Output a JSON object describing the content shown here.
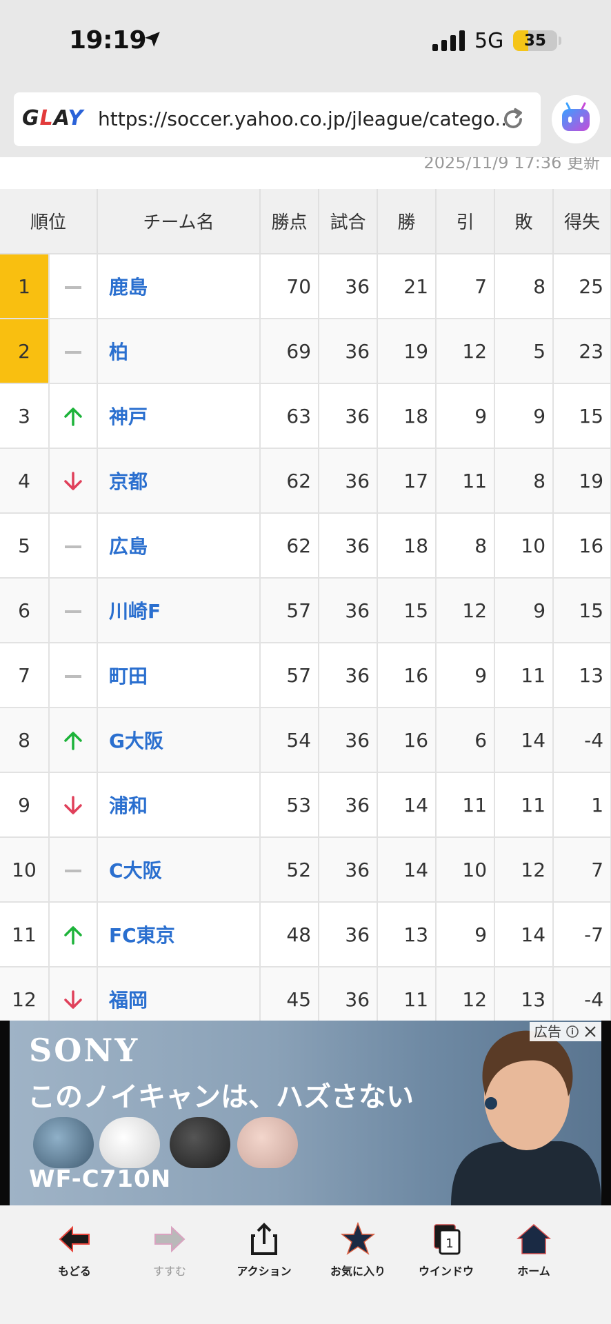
{
  "status_bar": {
    "time": "19:19",
    "network": "5G",
    "battery": "35",
    "battery_level": 0.35
  },
  "browser": {
    "logo": "GLAY",
    "url": "https://soccer.yahoo.co.jp/jleague/catego...",
    "updated": "2025/11/9 17:36 更新"
  },
  "table": {
    "headers": [
      "順位",
      "チーム名",
      "勝点",
      "試合",
      "勝",
      "引",
      "敗",
      "得失"
    ],
    "rows": [
      {
        "rank": "1",
        "trend": "flat",
        "team": "鹿島",
        "pts": "70",
        "played": "36",
        "w": "21",
        "d": "7",
        "l": "8",
        "gd": "25",
        "highlight": true
      },
      {
        "rank": "2",
        "trend": "flat",
        "team": "柏",
        "pts": "69",
        "played": "36",
        "w": "19",
        "d": "12",
        "l": "5",
        "gd": "23",
        "highlight": true
      },
      {
        "rank": "3",
        "trend": "up",
        "team": "神戸",
        "pts": "63",
        "played": "36",
        "w": "18",
        "d": "9",
        "l": "9",
        "gd": "15"
      },
      {
        "rank": "4",
        "trend": "down",
        "team": "京都",
        "pts": "62",
        "played": "36",
        "w": "17",
        "d": "11",
        "l": "8",
        "gd": "19"
      },
      {
        "rank": "5",
        "trend": "flat",
        "team": "広島",
        "pts": "62",
        "played": "36",
        "w": "18",
        "d": "8",
        "l": "10",
        "gd": "16"
      },
      {
        "rank": "6",
        "trend": "flat",
        "team": "川崎F",
        "pts": "57",
        "played": "36",
        "w": "15",
        "d": "12",
        "l": "9",
        "gd": "15"
      },
      {
        "rank": "7",
        "trend": "flat",
        "team": "町田",
        "pts": "57",
        "played": "36",
        "w": "16",
        "d": "9",
        "l": "11",
        "gd": "13"
      },
      {
        "rank": "8",
        "trend": "up",
        "team": "G大阪",
        "pts": "54",
        "played": "36",
        "w": "16",
        "d": "6",
        "l": "14",
        "gd": "-4"
      },
      {
        "rank": "9",
        "trend": "down",
        "team": "浦和",
        "pts": "53",
        "played": "36",
        "w": "14",
        "d": "11",
        "l": "11",
        "gd": "1"
      },
      {
        "rank": "10",
        "trend": "flat",
        "team": "C大阪",
        "pts": "52",
        "played": "36",
        "w": "14",
        "d": "10",
        "l": "12",
        "gd": "7"
      },
      {
        "rank": "11",
        "trend": "up",
        "team": "FC東京",
        "pts": "48",
        "played": "36",
        "w": "13",
        "d": "9",
        "l": "14",
        "gd": "-7"
      },
      {
        "rank": "12",
        "trend": "down",
        "team": "福岡",
        "pts": "45",
        "played": "36",
        "w": "11",
        "d": "12",
        "l": "13",
        "gd": "-4"
      }
    ]
  },
  "ad": {
    "brand": "SONY",
    "tagline": "このノイキャンは、ハズさない",
    "model": "WF-C710N",
    "label": "広告"
  },
  "toolbar": {
    "back": "もどる",
    "forward": "すすむ",
    "action": "アクション",
    "favorites": "お気に入り",
    "window": "ウインドウ",
    "window_count": "1",
    "home": "ホーム"
  },
  "colors": {
    "highlight": "#f9bf10",
    "team_link": "#2a6fcf",
    "up_arrow": "#1db33a",
    "down_arrow": "#e0405a"
  }
}
